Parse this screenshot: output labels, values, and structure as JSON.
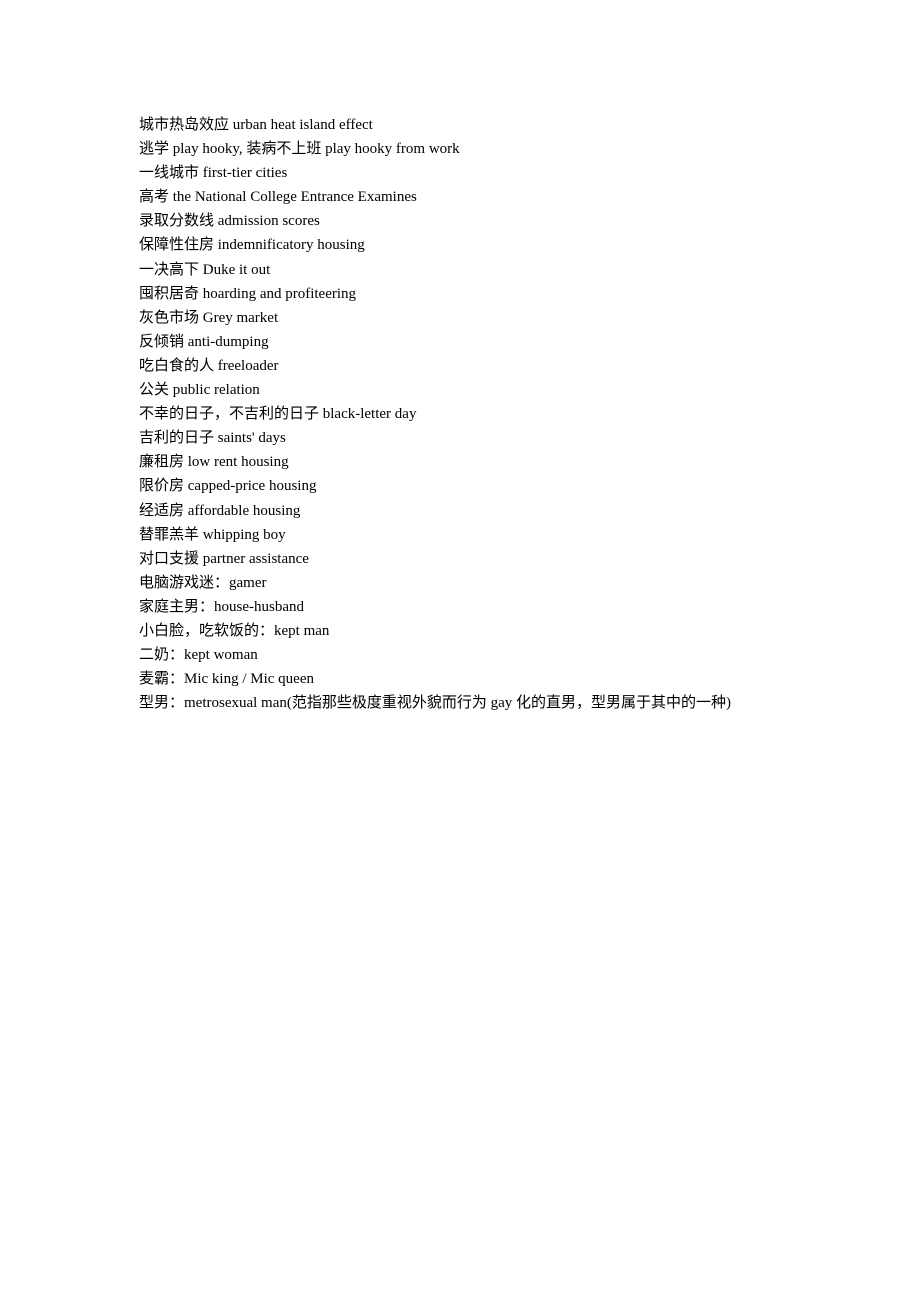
{
  "document": {
    "lines": [
      "城市热岛效应  urban heat island effect",
      "逃学  play hooky, 装病不上班  play hooky from work",
      "一线城市  first-tier cities",
      "高考  the National College Entrance Examines",
      "录取分数线  admission scores",
      "保障性住房  indemnificatory housing",
      "一决高下  Duke it out",
      "囤积居奇  hoarding and profiteering",
      "灰色市场  Grey market",
      "反倾销  anti-dumping",
      "吃白食的人  freeloader",
      "公关  public relation",
      "不幸的日子，不吉利的日子  black-letter day",
      "吉利的日子  saints' days",
      "廉租房  low rent housing",
      "限价房  capped-price housing",
      "经适房  affordable housing",
      "替罪羔羊  whipping boy",
      "对口支援  partner assistance",
      "电脑游戏迷：gamer",
      "家庭主男：house-husband",
      "小白脸，吃软饭的：kept man",
      "二奶：kept woman",
      "麦霸：Mic king / Mic queen",
      "型男：metrosexual man(范指那些极度重视外貌而行为 gay 化的直男，型男属于其中的一种)"
    ]
  }
}
